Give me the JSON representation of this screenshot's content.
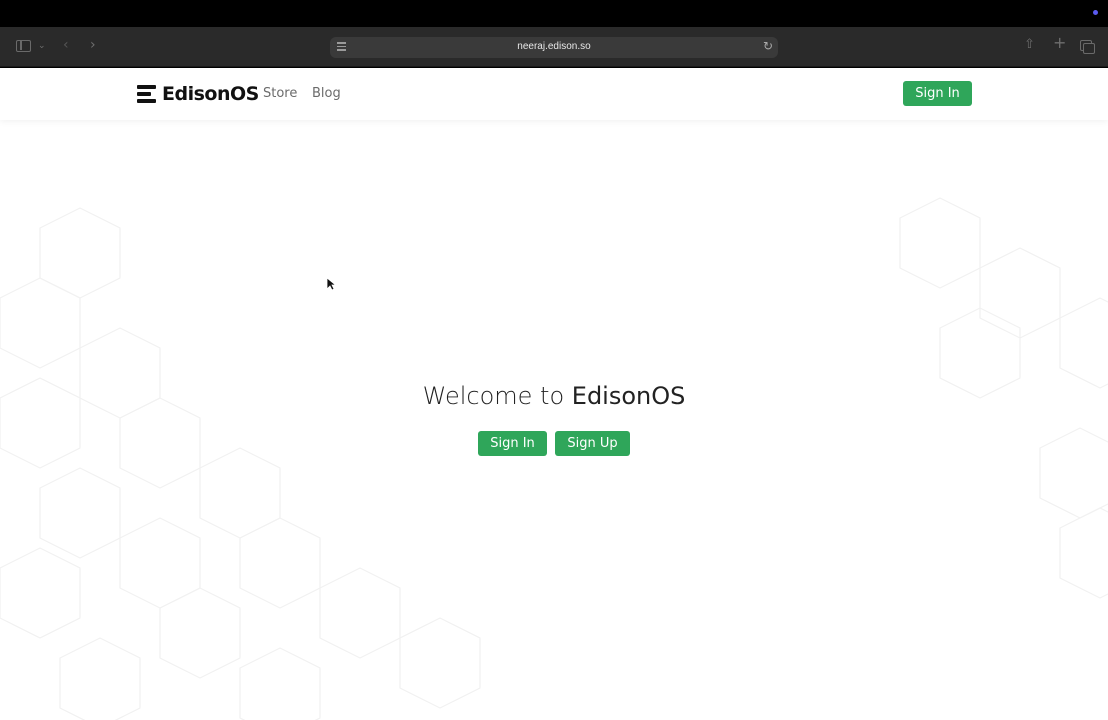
{
  "browser": {
    "url": "neeraj.edison.so",
    "icons": [
      "sidebar-icon",
      "chevron-down-icon",
      "back-icon",
      "forward-icon",
      "site-settings-icon",
      "reload-icon",
      "share-icon",
      "new-tab-icon",
      "tab-overview-icon"
    ]
  },
  "nav": {
    "brand": "EdisonOS",
    "links": [
      "Store",
      "Blog"
    ],
    "signin_label": "Sign In"
  },
  "hero": {
    "title_prefix": "Welcome to",
    "title_brand": "EdisonOS",
    "signin_label": "Sign In",
    "signup_label": "Sign Up"
  },
  "colors": {
    "accent": "#2fa65a",
    "toolbar": "#2a2a2a",
    "page_bg": "#ffffff"
  }
}
